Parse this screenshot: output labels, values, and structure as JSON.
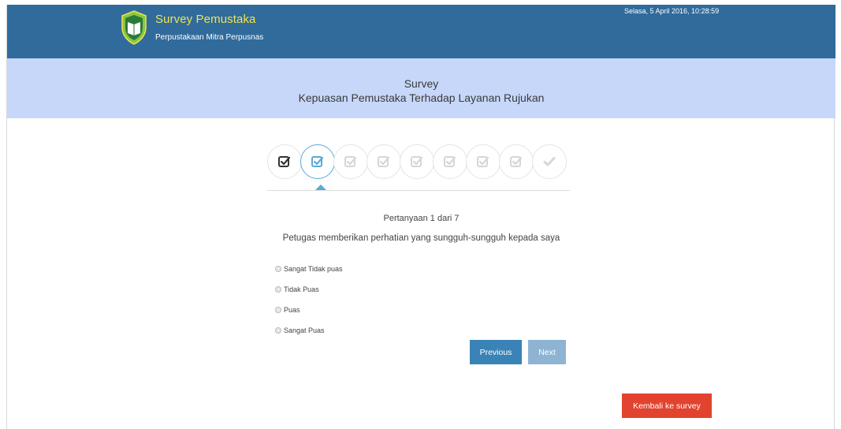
{
  "header": {
    "app_title": "Survey Pemustaka",
    "app_subtitle": "Perpustakaan Mitra Perpusnas",
    "datetime": "Selasa, 5 April 2016, 10:28:59"
  },
  "banner": {
    "line1": "Survey",
    "line2": "Kepuasan Pemustaka Terhadap Layanan Rujukan"
  },
  "stepper": {
    "steps": [
      "done",
      "active",
      "pending",
      "pending",
      "pending",
      "pending",
      "pending",
      "pending",
      "finish"
    ]
  },
  "question": {
    "counter": "Pertanyaan 1 dari 7",
    "text": "Petugas memberikan perhatian yang sungguh-sungguh kepada saya",
    "options": [
      "Sangat Tidak puas",
      "Tidak Puas",
      "Puas",
      "Sangat Puas"
    ]
  },
  "buttons": {
    "previous": "Previous",
    "next": "Next",
    "back_to_survey": "Kembali ke survey"
  },
  "colors": {
    "header_bg": "#306b9c",
    "title_yellow": "#f2e24d",
    "banner_bg": "#c6d7fa",
    "primary_button": "#3983b6",
    "disabled_button": "#8fb4d3",
    "danger_button": "#e2432e",
    "step_active": "#5aa9d6"
  }
}
